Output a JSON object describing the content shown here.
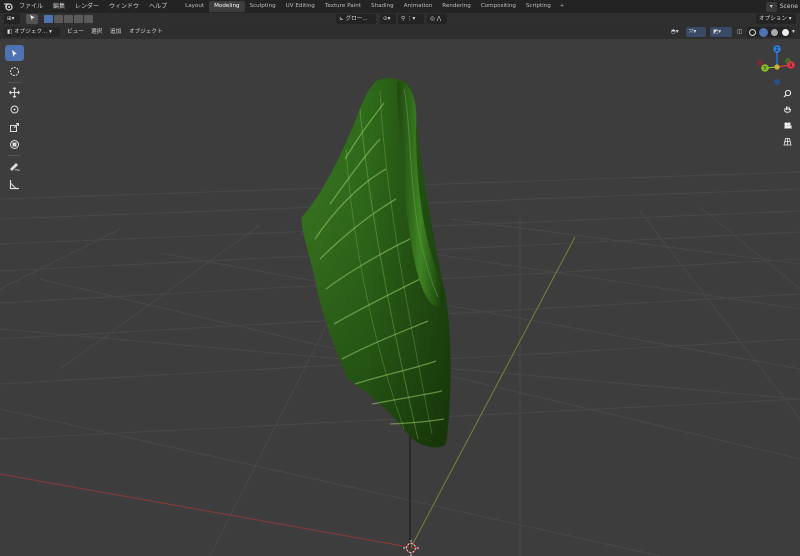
{
  "menubar": {
    "items": [
      "ファイル",
      "編集",
      "レンダー",
      "ウィンドウ",
      "ヘルプ"
    ]
  },
  "workspaces": {
    "tabs": [
      "Layout",
      "Modeling",
      "Sculpting",
      "UV Editing",
      "Texture Paint",
      "Shading",
      "Animation",
      "Rendering",
      "Compositing",
      "Scripting"
    ],
    "active": "Modeling",
    "add_label": "+"
  },
  "scene": {
    "label": "Scene"
  },
  "tool_header": {
    "transform_orientation": "グロー...",
    "options_label": "オプション"
  },
  "viewport_header": {
    "mode": "オブジェク...",
    "menus": [
      "ビュー",
      "選択",
      "追加",
      "オブジェクト"
    ]
  },
  "gizmo": {
    "x": "X",
    "y": "Y",
    "z": "Z"
  },
  "colors": {
    "accent": "#4f72b3",
    "axis_x": "#e0394a",
    "axis_y": "#86bb2a",
    "axis_z": "#2f7fe3",
    "viewport_bg": "#3d3d3d",
    "header_bg": "#2e2e2e",
    "topbar_bg": "#232323"
  },
  "icons": {
    "blender_logo": "blender-logo-icon",
    "select": "select-box-icon",
    "cursor": "cursor-icon",
    "move": "move-icon",
    "rotate": "rotate-icon",
    "scale": "scale-icon",
    "transform": "transform-icon",
    "annotate": "annotate-icon",
    "measure": "measure-icon",
    "zoom": "zoom-icon",
    "pan": "hand-icon",
    "camera": "camera-icon",
    "perspective": "grid-icon"
  }
}
